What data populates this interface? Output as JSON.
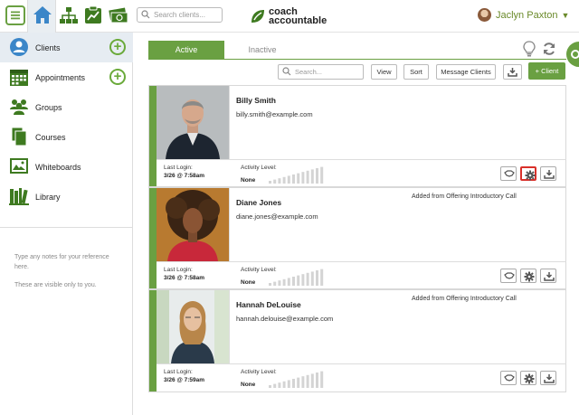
{
  "header": {
    "search_placeholder": "Search clients...",
    "logo_line1": "coach",
    "logo_line2": "accountable",
    "user_name": "Jaclyn Paxton",
    "user_caret": "▼"
  },
  "sidebar": {
    "items": [
      {
        "label": "Clients",
        "icon": "clients-icon"
      },
      {
        "label": "Appointments",
        "icon": "calendar-icon"
      },
      {
        "label": "Groups",
        "icon": "groups-icon"
      },
      {
        "label": "Courses",
        "icon": "courses-icon"
      },
      {
        "label": "Whiteboards",
        "icon": "whiteboard-icon"
      },
      {
        "label": "Library",
        "icon": "library-icon"
      }
    ],
    "notes_line1": "Type any notes for your reference here.",
    "notes_line2": "These are visible only to you."
  },
  "tabs": {
    "active": "Active",
    "inactive": "Inactive"
  },
  "toolbar": {
    "search_placeholder": "Search...",
    "view": "View",
    "sort": "Sort",
    "message": "Message Clients",
    "add_client": "+ Client"
  },
  "clients": [
    {
      "name": "Billy Smith",
      "email": "billy.smith@example.com",
      "note": "",
      "last_login_label": "Last Login:",
      "last_login": "3/26 @ 7:58am",
      "activity_label": "Activity Level:",
      "activity": "None"
    },
    {
      "name": "Diane Jones",
      "email": "diane.jones@example.com",
      "note": "Added from Offering Introductory Call",
      "last_login_label": "Last Login:",
      "last_login": "3/26 @ 7:58am",
      "activity_label": "Activity Level:",
      "activity": "None"
    },
    {
      "name": "Hannah DeLouise",
      "email": "hannah.delouise@example.com",
      "note": "Added from Offering Introductory Call",
      "last_login_label": "Last Login:",
      "last_login": "3/26 @ 7:59am",
      "activity_label": "Activity Level:",
      "activity": "None"
    }
  ],
  "colors": {
    "accent": "#6aa042",
    "highlight": "#d9302a"
  }
}
